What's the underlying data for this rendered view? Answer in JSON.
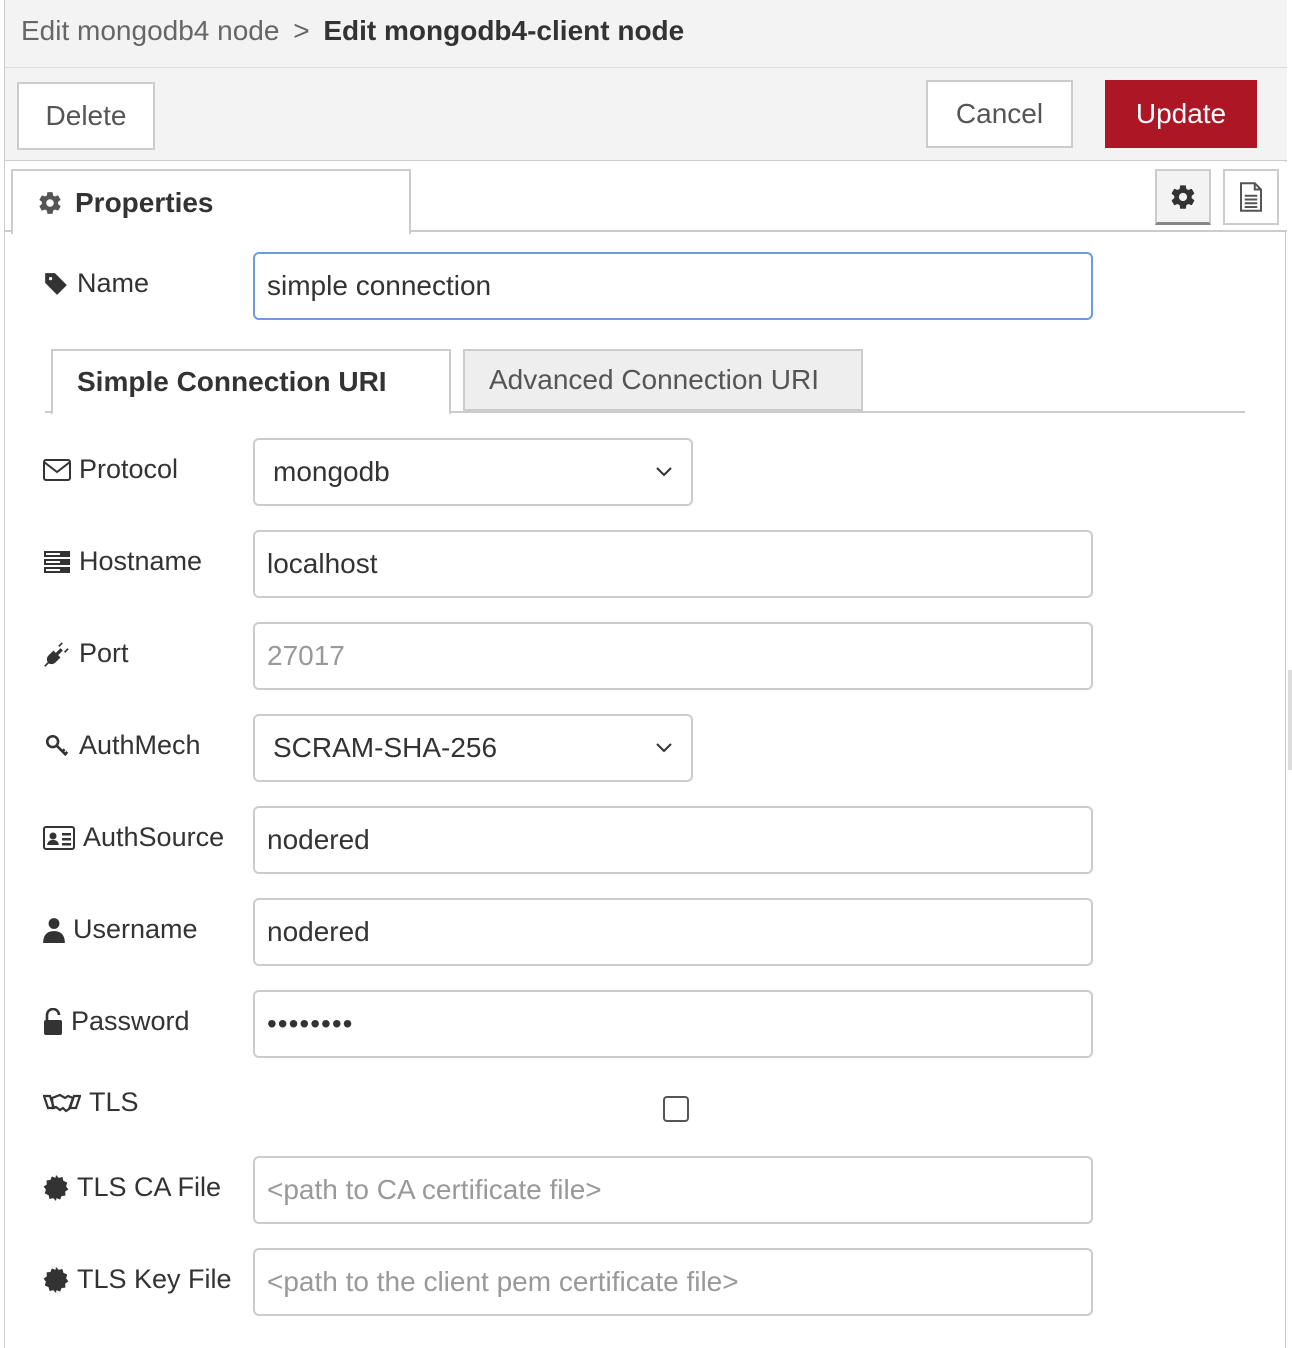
{
  "header": {
    "breadcrumb_prev": "Edit mongodb4 node",
    "breadcrumb_sep": ">",
    "breadcrumb_current": "Edit mongodb4-client node"
  },
  "toolbar": {
    "delete_label": "Delete",
    "cancel_label": "Cancel",
    "update_label": "Update",
    "update_color": "#ad1625"
  },
  "tabs": {
    "properties_label": "Properties"
  },
  "form": {
    "name": {
      "label": "Name",
      "value": "simple connection"
    },
    "connection_tabs": {
      "simple": "Simple Connection URI",
      "advanced": "Advanced Connection URI"
    },
    "protocol": {
      "label": "Protocol",
      "value": "mongodb"
    },
    "hostname": {
      "label": "Hostname",
      "value": "localhost"
    },
    "port": {
      "label": "Port",
      "placeholder": "27017"
    },
    "authmech": {
      "label": "AuthMech",
      "value": "SCRAM-SHA-256"
    },
    "authsource": {
      "label": "AuthSource",
      "value": "nodered"
    },
    "username": {
      "label": "Username",
      "value": "nodered"
    },
    "password": {
      "label": "Password",
      "value": "••••••••"
    },
    "tls": {
      "label": "TLS",
      "checked": false
    },
    "tls_ca_file": {
      "label": "TLS CA File",
      "placeholder": "<path to CA certificate file>"
    },
    "tls_key_file": {
      "label": "TLS Key File",
      "placeholder": "<path to the client pem certificate file>"
    }
  }
}
